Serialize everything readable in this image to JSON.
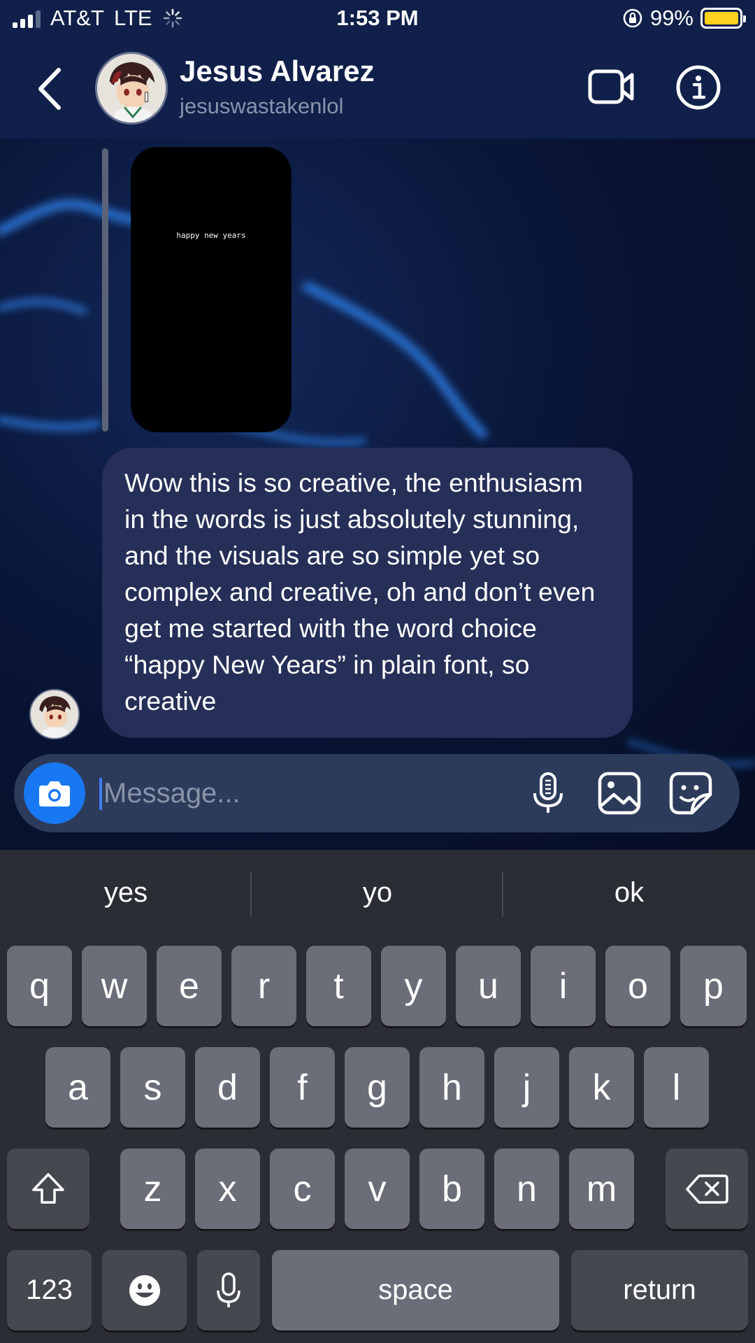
{
  "status_bar": {
    "carrier": "AT&T",
    "network": "LTE",
    "time": "1:53 PM",
    "battery": "99%",
    "battery_level": 0.99
  },
  "header": {
    "name": "Jesus Alvarez",
    "username": "jesuswastakenlol"
  },
  "story": {
    "text": "happy new years"
  },
  "message": {
    "text": "Wow this is so creative, the enthusiasm in the words is just absolutely stunning, and the visuals are so simple yet so complex and creative, oh and don’t even get me started with the word choice “happy New Years” in plain font, so creative"
  },
  "composer": {
    "placeholder": "Message..."
  },
  "keyboard": {
    "suggestions": [
      "yes",
      "yo",
      "ok"
    ],
    "row1": [
      "q",
      "w",
      "e",
      "r",
      "t",
      "y",
      "u",
      "i",
      "o",
      "p"
    ],
    "row2": [
      "a",
      "s",
      "d",
      "f",
      "g",
      "h",
      "j",
      "k",
      "l"
    ],
    "row3": [
      "z",
      "x",
      "c",
      "v",
      "b",
      "n",
      "m"
    ],
    "numbers_label": "123",
    "space_label": "space",
    "return_label": "return"
  },
  "colors": {
    "accent": "#1877f2",
    "bubble": "#252f57",
    "battery": "#ffd21e"
  }
}
